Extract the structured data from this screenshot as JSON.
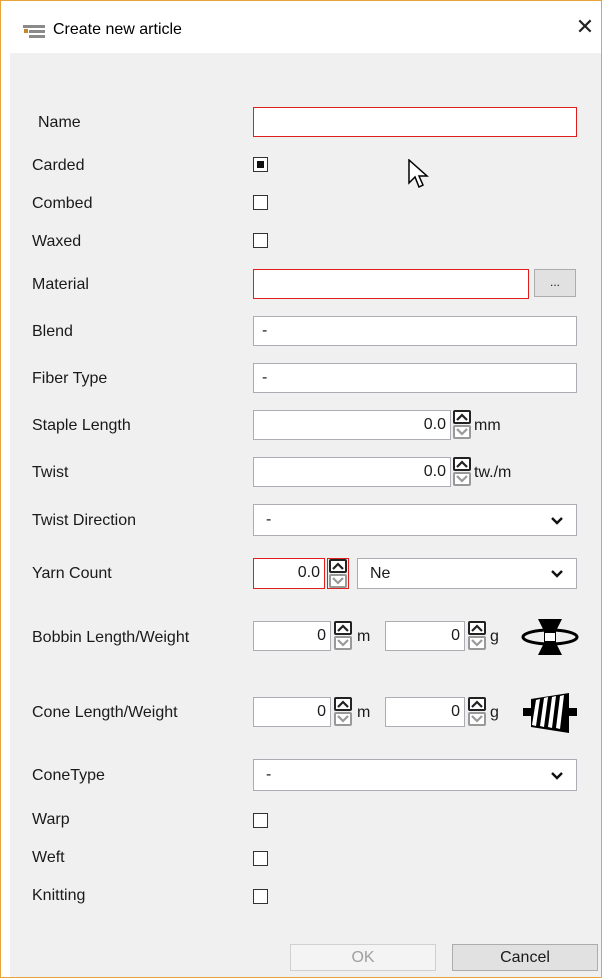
{
  "window": {
    "title": "Create new article",
    "close_symbol": "✕"
  },
  "form": {
    "name": {
      "label": "Name",
      "value": ""
    },
    "carded": {
      "label": "Carded",
      "checked": true
    },
    "combed": {
      "label": "Combed",
      "checked": false
    },
    "waxed": {
      "label": "Waxed",
      "checked": false
    },
    "material": {
      "label": "Material",
      "value": "",
      "browse_label": "..."
    },
    "blend": {
      "label": "Blend",
      "value": "-"
    },
    "fiber_type": {
      "label": "Fiber Type",
      "value": "-"
    },
    "staple_length": {
      "label": "Staple Length",
      "value": "0.0",
      "unit": "mm"
    },
    "twist": {
      "label": "Twist",
      "value": "0.0",
      "unit": "tw./m"
    },
    "twist_direction": {
      "label": "Twist Direction",
      "selected": "-"
    },
    "yarn_count": {
      "label": "Yarn Count",
      "value": "0.0",
      "unit_selected": "Ne"
    },
    "bobbin": {
      "label": "Bobbin Length/Weight",
      "length": "0",
      "length_unit": "m",
      "weight": "0",
      "weight_unit": "g"
    },
    "cone": {
      "label": "Cone Length/Weight",
      "length": "0",
      "length_unit": "m",
      "weight": "0",
      "weight_unit": "g"
    },
    "cone_type": {
      "label": "ConeType",
      "selected": "-"
    },
    "warp": {
      "label": "Warp",
      "checked": false
    },
    "weft": {
      "label": "Weft",
      "checked": false
    },
    "knitting": {
      "label": "Knitting",
      "checked": false
    }
  },
  "buttons": {
    "ok": "OK",
    "cancel": "Cancel"
  },
  "icons": {
    "chevron": "chevron-down-icon",
    "bobbin": "bobbin-icon",
    "cone": "cone-icon"
  },
  "colors": {
    "error_border": "#e01e1e",
    "window_border": "#e8a33d"
  }
}
